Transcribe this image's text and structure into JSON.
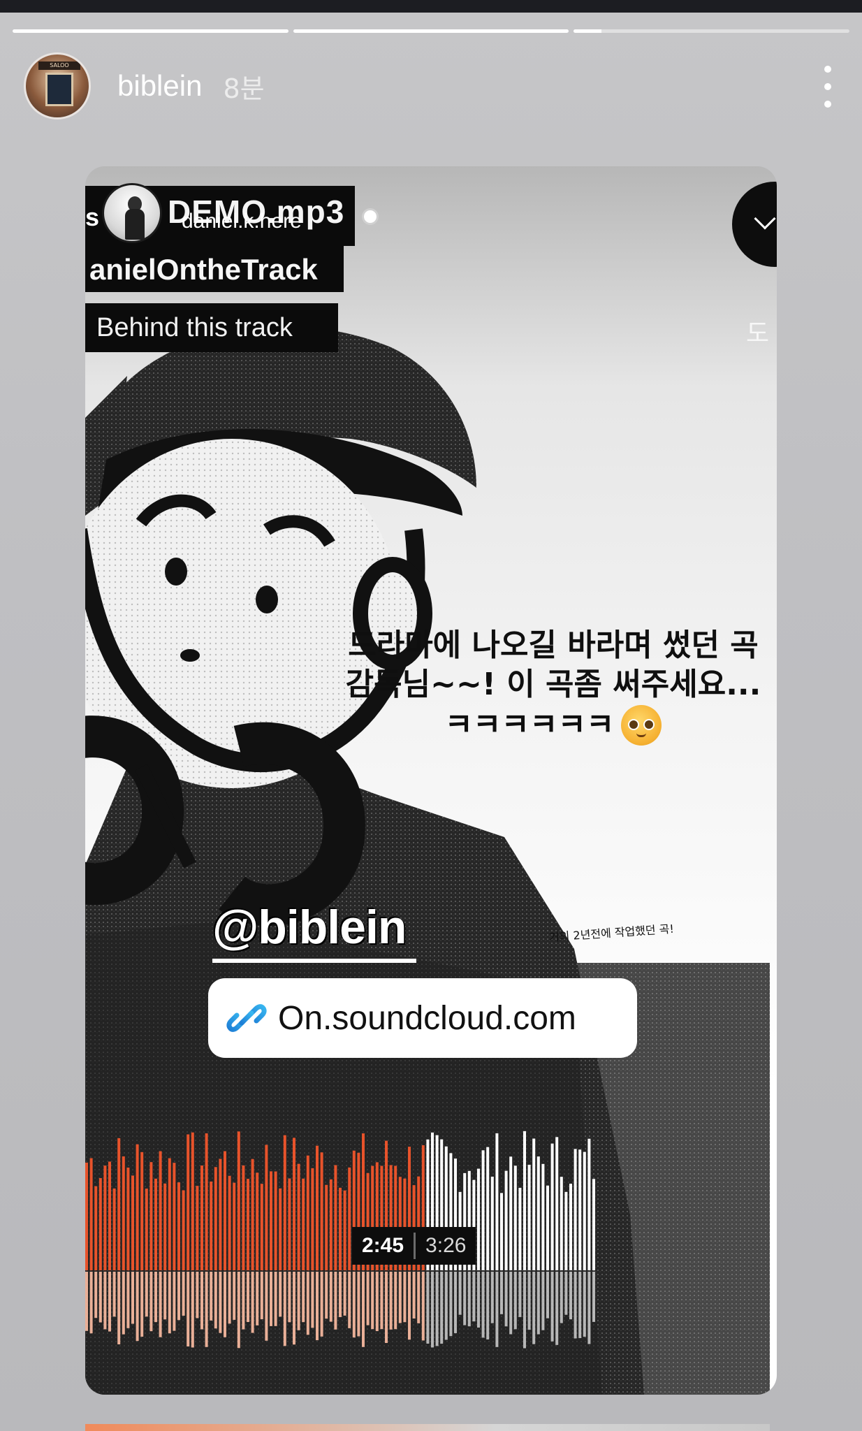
{
  "story": {
    "progress": [
      1.0,
      1.0,
      0.1
    ],
    "user": {
      "username": "biblein",
      "time_ago": "8분"
    },
    "avatar_sign": "SALOO"
  },
  "shared_post": {
    "overlay_labels": {
      "prefix_fragment": "s",
      "demo_title": "DEMO.mp3",
      "author_handle": "daniel.k.here",
      "artist_tag": "anielOntheTrack",
      "behind_label": "Behind this track"
    },
    "side_glyph": "도",
    "caption": {
      "line1": "드라마에 나오길 바라며 썼던 곡",
      "line2": "감독님~~! 이 곡좀 써주세요...",
      "line3": "ㅋㅋㅋㅋㅋㅋ"
    },
    "small_note": "거의 2년전에 작업했던 곡!",
    "mention": "@biblein",
    "link": {
      "text": "On.soundcloud.com"
    },
    "player": {
      "current_time": "2:45",
      "total_time": "3:26",
      "played_fraction": 0.8
    },
    "colors": {
      "played": "#e8532b",
      "unplayed": "#ffffff",
      "reflection_played": "#f4b79e"
    }
  }
}
